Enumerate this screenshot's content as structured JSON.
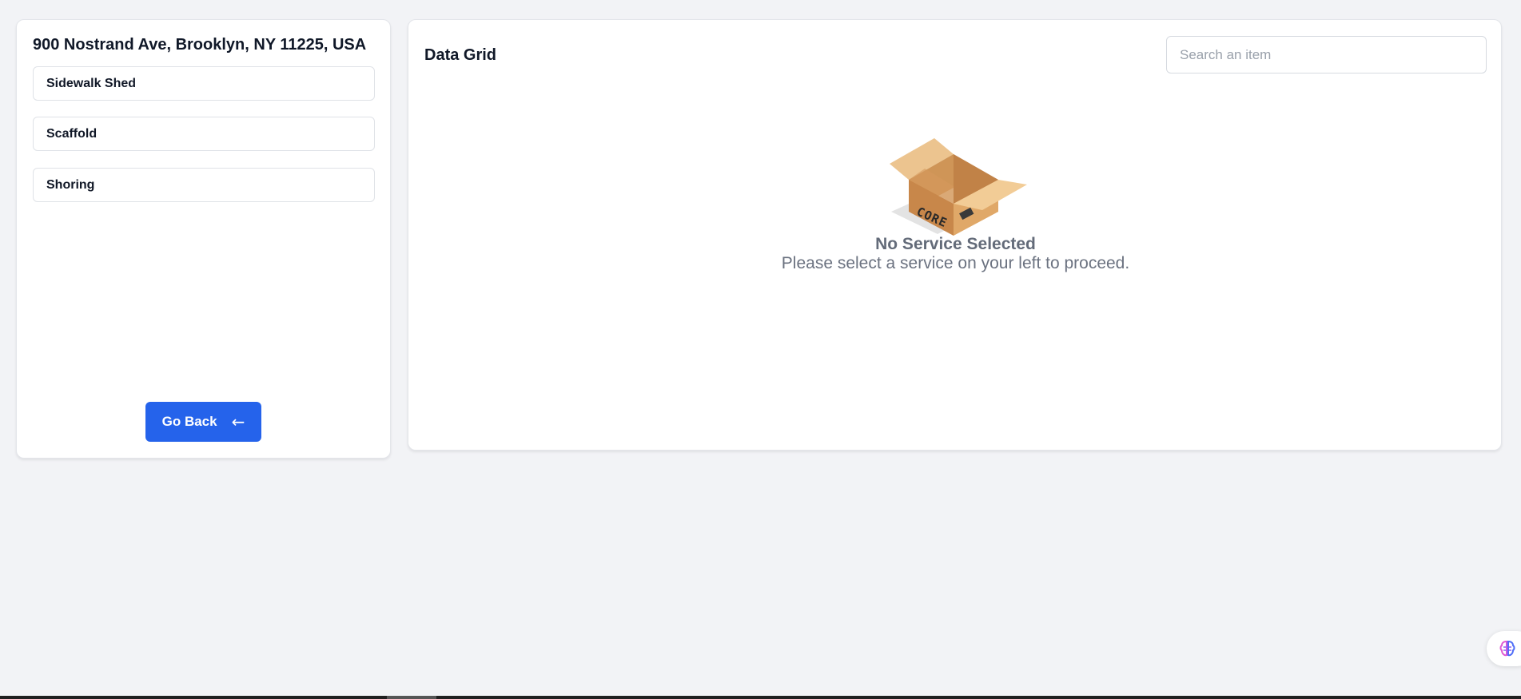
{
  "left_panel": {
    "address": "900 Nostrand Ave, Brooklyn, NY 11225, USA",
    "services": [
      {
        "label": "Sidewalk Shed"
      },
      {
        "label": "Scaffold"
      },
      {
        "label": "Shoring"
      }
    ],
    "go_back_label": "Go Back",
    "go_back_icon": "←"
  },
  "right_panel": {
    "title": "Data Grid",
    "search": {
      "placeholder": "Search an item",
      "value": ""
    },
    "empty_state": {
      "box_label": "CORE",
      "title": "No Service Selected",
      "subtitle": "Please select a service on your left to proceed."
    }
  },
  "floating": {
    "icon": "brain-icon"
  },
  "colors": {
    "background": "#f2f3f6",
    "accent": "#2563eb",
    "panel": "#ffffff"
  }
}
